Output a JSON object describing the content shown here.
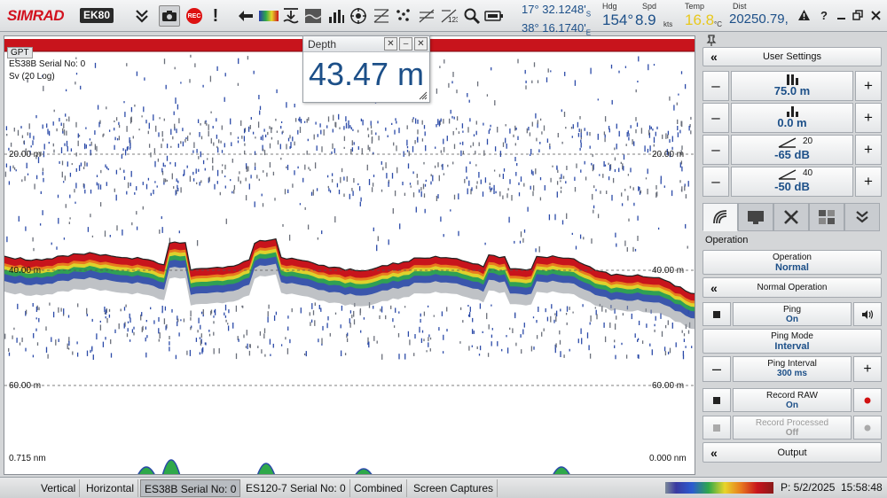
{
  "app": {
    "brand": "SIMRAD",
    "model": "EK80"
  },
  "toolbar": {
    "icons": [
      "expand-chevron-icon",
      "camera-icon",
      "record-icon",
      "alert-icon",
      "back-arrow-icon",
      "color-scale-icon",
      "bottom-detect-icon",
      "echogram-icon",
      "bar-chart-icon",
      "target-icon",
      "grid-icon",
      "scatter-icon",
      "histogram-icon",
      "numeric-icon",
      "zoom-icon",
      "battery-icon"
    ],
    "rec_label": "REC"
  },
  "navigation": {
    "lat": "17° 32.1248'",
    "lat_hemi": "S",
    "lon": "38° 16.1740'",
    "lon_hemi": "E",
    "hdg_label": "Hdg",
    "hdg_value": "154°",
    "spd_label": "Spd",
    "spd_value": "8.9",
    "spd_unit": "kts",
    "temp_label": "Temp",
    "temp_value": "16.8",
    "temp_unit": "°C",
    "dist_label": "Dist",
    "dist_value": "20250.79,"
  },
  "window_controls": [
    "warning-icon",
    "help-icon",
    "minimize-icon",
    "restore-icon",
    "close-icon"
  ],
  "echogram": {
    "channel_short": "GPT",
    "channel": "ES38B Serial No: 0",
    "variable": "Sv (20 Log)",
    "range_labels": [
      {
        "left": "20.00 m",
        "right": "20.00 m"
      },
      {
        "left": "40.00 m",
        "right": "40.00 m"
      },
      {
        "left": "60.00 m",
        "right": "60.00 m"
      }
    ],
    "distance_left": "0.715 nm",
    "distance_right": "0.000 nm"
  },
  "depth_window": {
    "title": "Depth",
    "value": "43.47 m"
  },
  "panel": {
    "user_settings": "User Settings",
    "range": "75.0 m",
    "start": "0.0 m",
    "gain_top_label": "20",
    "gain_top": "-65 dB",
    "gain_bottom_label": "40",
    "gain_bottom": "-50 dB",
    "tabs": [
      "sonar-tab-icon",
      "display-tab-icon",
      "setup-tab-icon",
      "layout-tab-icon",
      "install-tab-icon"
    ],
    "section": "Operation",
    "operation_label": "Operation",
    "operation_value": "Normal",
    "normal_operation": "Normal Operation",
    "ping_label": "Ping",
    "ping_value": "On",
    "ping_mode_label": "Ping Mode",
    "ping_mode_value": "Interval",
    "ping_interval_label": "Ping Interval",
    "ping_interval_value": "300 ms",
    "record_raw_label": "Record RAW",
    "record_raw_value": "On",
    "record_processed_label": "Record Processed",
    "record_processed_value": "Off",
    "output": "Output"
  },
  "status_bar": {
    "tabs": [
      "Vertical",
      "Horizontal",
      "ES38B Serial No: 0",
      "ES120-7 Serial No: 0",
      "Combined",
      "Screen Captures"
    ],
    "active_tab": "ES38B Serial No: 0",
    "date": "P: 5/2/2025",
    "time": "15:58:48"
  },
  "colors": {
    "accent": "#1c4f88",
    "brand": "#d2121f",
    "echo_strong": "#c8141c",
    "rec_dot": "#d11111"
  }
}
